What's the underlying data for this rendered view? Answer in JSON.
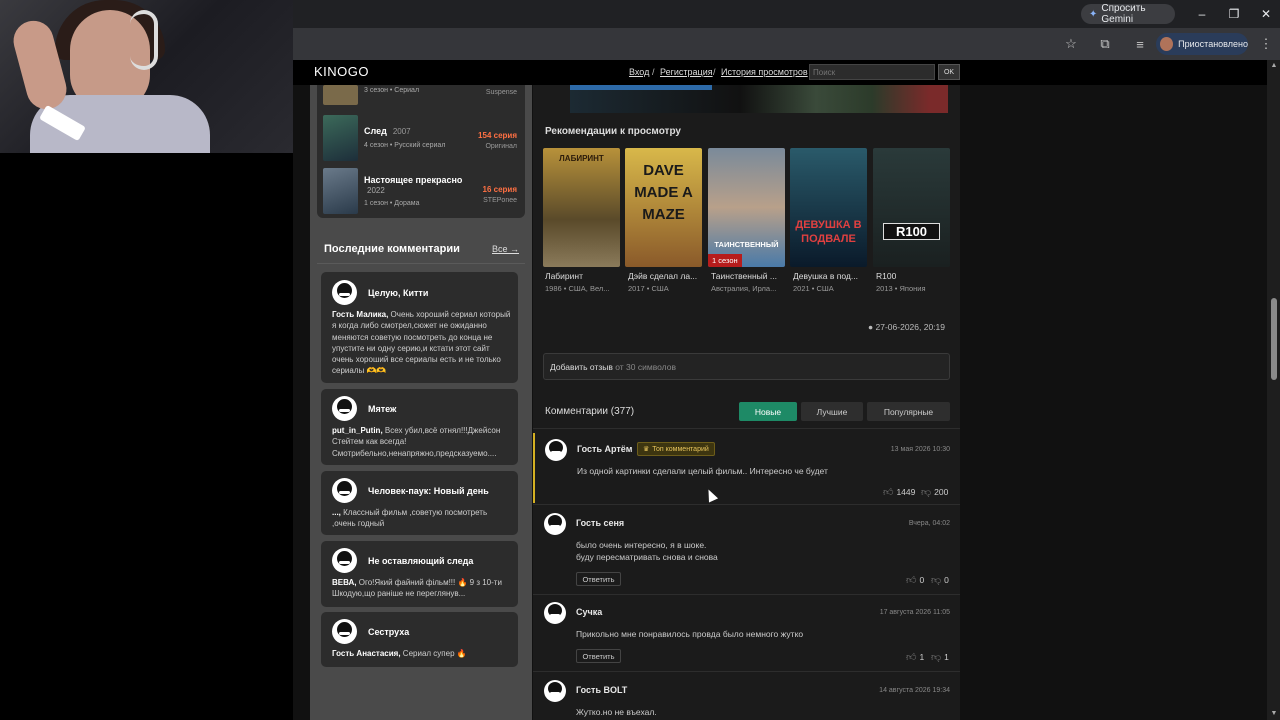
{
  "browser": {
    "gemini_label": "Спросить Gemini",
    "profile_label": "Приостановлено",
    "icons": [
      "star-icon",
      "extensions-icon",
      "media-icon",
      "menu-icon"
    ]
  },
  "header": {
    "logo": "KINOGO",
    "login": "Вход",
    "sep": "/",
    "register": "Регистрация",
    "history": "История просмотров",
    "search_placeholder": "Поиск",
    "ok": "OK"
  },
  "left_list": [
    {
      "title": "",
      "year": "",
      "meta": "3 сезон • Сериал",
      "episodes": "",
      "studio": "Suspense",
      "color": "#7a6a4a"
    },
    {
      "title": "След",
      "year": "2007",
      "meta": "4 сезон • Русский сериал",
      "episodes": "154 серия",
      "studio": "Оригинал",
      "color": "#3c6a5a"
    },
    {
      "title": "Настоящее прекрасно",
      "year": "2022",
      "meta": "1 сезон • Дорама",
      "episodes": "16 серия",
      "studio": "STEPonee",
      "color": "#6a7a8a"
    }
  ],
  "latest_comments": {
    "heading": "Последние комментарии",
    "all": "Все →",
    "items": [
      {
        "title": "Целую, Китти",
        "author": "Гость Малика,",
        "text": "Очень хороший сериал который я когда либо смотрел,сюжет не ожиданно меняются советую посмотреть до конца не упустите ни одну серию,и кстати этот сайт очень хороший все сериалы есть и не только сериалы 🫶🫶"
      },
      {
        "title": "Мятеж",
        "author": "put_in_Putin,",
        "text": "Всех убил,всё отнял!!!Джейсон Стейтем как всегда! Смотрибельно,ненапряжно,предсказуемо...."
      },
      {
        "title": "Человек-паук: Новый день",
        "author": "...,",
        "text": "Классный фильм ,советую посмотреть ,очень годный"
      },
      {
        "title": "Не оставляющий следа",
        "author": "ВЕВА,",
        "text": "Ого!Який файний фільм!!! 🔥 9 з 10-ти Шкодую,що раніше не переглянув..."
      },
      {
        "title": "Сеструха",
        "author": "Гость Анастасия,",
        "text": "Сериал супер 🔥"
      }
    ]
  },
  "recommendations": {
    "heading": "Рекомендации к просмотру",
    "items": [
      {
        "name": "Лабиринт",
        "meta": "1986 • США, Вел...",
        "poster_text": "ЛАБИРИНТ",
        "color": "#9a7a3a",
        "badge": ""
      },
      {
        "name": "Дэйв сделал ла...",
        "meta": "2017 • США",
        "poster_text": "DAVE MADE A MAZE",
        "color": "#c8a23a",
        "badge": ""
      },
      {
        "name": "Таинственный ...",
        "meta": "Австралия, Ирла...",
        "poster_text": "ТАИНСТВЕННЫЙ",
        "color": "#6a8aa8",
        "badge": "1 сезон"
      },
      {
        "name": "Девушка в под...",
        "meta": "2021 • США",
        "poster_text": "ДЕВУШКА В ПОДВАЛЕ",
        "color": "#1a3a4a",
        "badge": ""
      },
      {
        "name": "R100",
        "meta": "2013 • Япония",
        "poster_text": "R100",
        "color": "#1a2a2a",
        "badge": ""
      }
    ]
  },
  "post_date": "27-06-2026, 20:19",
  "review": {
    "label": "Добавить отзыв",
    "hint": "от 30 символов"
  },
  "comments": {
    "count_label": "Комментарии (377)",
    "tabs": [
      "Новые",
      "Лучшие",
      "Популярные"
    ],
    "top_badge": "Топ комментарий",
    "reply": "Ответить",
    "items": [
      {
        "author": "Гость Артём",
        "date": "13 мая 2026 10:30",
        "text": "Из одной картинки сделали целый фильм.. Интересно че будет",
        "likes": "1449",
        "dislikes": "200"
      },
      {
        "author": "Гость сеня",
        "date": "Вчера, 04:02",
        "text": "было очень интересно, я в шоке.",
        "text2": "буду пересматривать снова и снова",
        "likes": "0",
        "dislikes": "0"
      },
      {
        "author": "Сучка",
        "date": "17 августа 2026 11:05",
        "text": "Прикольно мне понравилось провда было немного жутко",
        "likes": "1",
        "dislikes": "1"
      },
      {
        "author": "Гость BOLT",
        "date": "14 августа 2026 19:34",
        "text": "Жутко.но не въехал."
      }
    ]
  }
}
